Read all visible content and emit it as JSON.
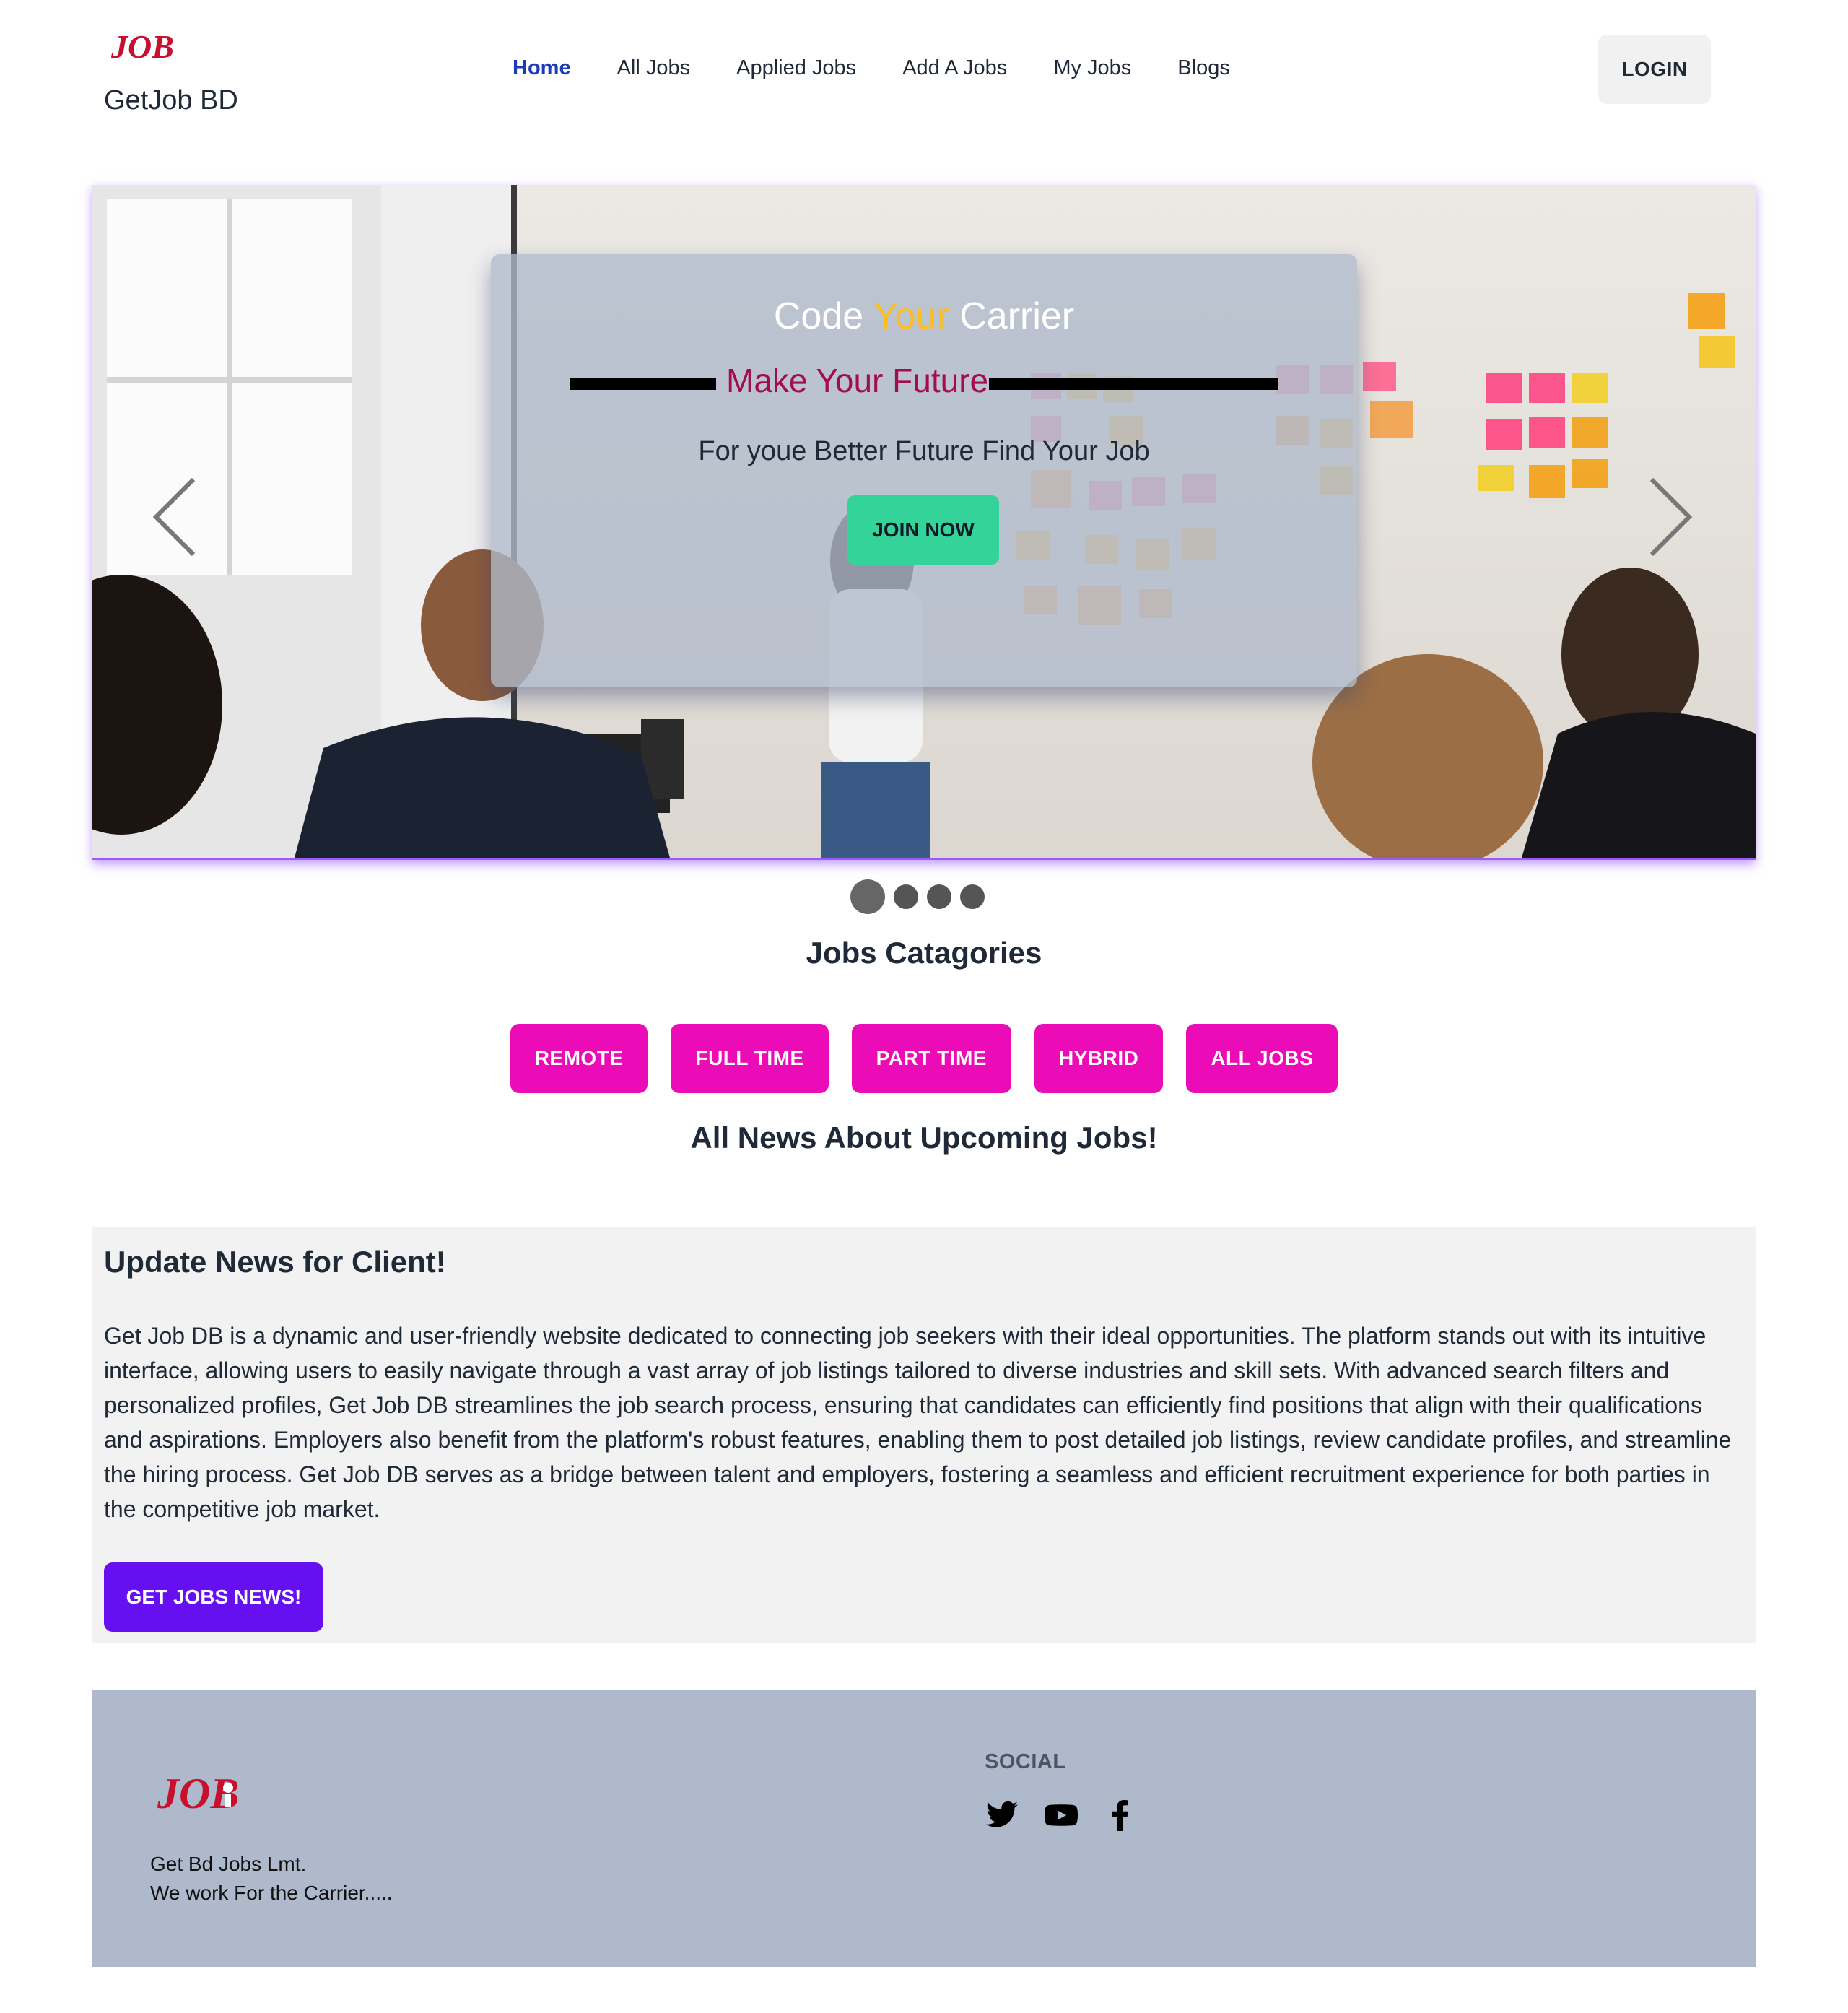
{
  "brand": {
    "logo_text": "JOB",
    "name": "GetJob BD"
  },
  "nav": {
    "items": [
      {
        "label": "Home",
        "active": true
      },
      {
        "label": "All Jobs"
      },
      {
        "label": "Applied Jobs"
      },
      {
        "label": "Add A Jobs"
      },
      {
        "label": "My Jobs"
      },
      {
        "label": "Blogs"
      }
    ],
    "login_label": "LOGIN"
  },
  "hero": {
    "title_part1": "Code ",
    "title_accent": "Your",
    "title_part2": " Carrier",
    "subtitle": "Make Your Future",
    "description": "For youe Better Future Find Your Job",
    "cta_label": "JOIN NOW",
    "slide_count": 4,
    "active_slide": 1
  },
  "categories": {
    "title": "Jobs Catagories",
    "items": [
      "REMOTE",
      "FULL TIME",
      "PART TIME",
      "HYBRID",
      "ALL JOBS"
    ]
  },
  "news_heading": "All News About Upcoming Jobs!",
  "news": {
    "title": "Update News for Client!",
    "body": "Get Job DB is a dynamic and user-friendly website dedicated to connecting job seekers with their ideal opportunities. The platform stands out with its intuitive interface, allowing users to easily navigate through a vast array of job listings tailored to diverse industries and skill sets. With advanced search filters and personalized profiles, Get Job DB streamlines the job search process, ensuring that candidates can efficiently find positions that align with their qualifications and aspirations. Employers also benefit from the platform's robust features, enabling them to post detailed job listings, review candidate profiles, and streamline the hiring process. Get Job DB serves as a bridge between talent and employers, fostering a seamless and efficient recruitment experience for both parties in the competitive job market.",
    "button_label": "GET JOBS NEWS!"
  },
  "footer": {
    "logo_text": "JOB",
    "company_line1": "Get Bd Jobs Lmt.",
    "company_line2": "We work For the Carrier.....",
    "social_title": "SOCIAL",
    "social_icons": [
      "twitter-icon",
      "youtube-icon",
      "facebook-icon"
    ]
  },
  "colors": {
    "nav_active": "#1d3bb8",
    "category_button": "#ec0cb7",
    "news_button": "#6610f2",
    "join_button": "#34d399",
    "footer_bg": "#aebacc",
    "hero_accent": "#fbbf24",
    "hero_subtitle": "#a30d4f",
    "logo_red": "#c8102e"
  }
}
